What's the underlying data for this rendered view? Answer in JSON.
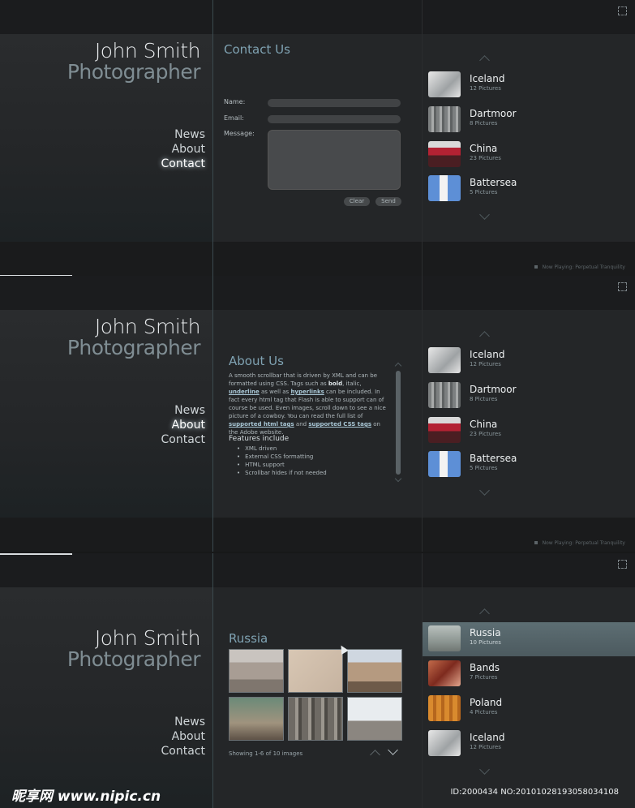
{
  "brand": {
    "name": "John Smith",
    "title": "Photographer"
  },
  "nav": [
    "News",
    "About",
    "Contact"
  ],
  "contact": {
    "title": "Contact Us",
    "labels": {
      "name": "Name:",
      "email": "Email:",
      "message": "Message:"
    },
    "buttons": {
      "clear": "Clear",
      "send": "Send"
    }
  },
  "galleries_a": [
    {
      "title": "Iceland",
      "count": "12 Pictures"
    },
    {
      "title": "Dartmoor",
      "count": "8 Pictures"
    },
    {
      "title": "China",
      "count": "23 Pictures"
    },
    {
      "title": "Battersea",
      "count": "5 Pictures"
    }
  ],
  "galleries_b": [
    {
      "title": "Russia",
      "count": "10 Pictures"
    },
    {
      "title": "Bands",
      "count": "7 Pictures"
    },
    {
      "title": "Poland",
      "count": "4 Pictures"
    },
    {
      "title": "Iceland",
      "count": "12 Pictures"
    }
  ],
  "now_playing": "Now Playing: Perpetual Tranquility",
  "about": {
    "title": "About Us",
    "p1": "A smooth scrollbar that is driven by XML and can be formatted using CSS. Tags such as",
    "bold": "bold",
    "p2": ", italic,",
    "underline": "underline",
    "p3": "as well as",
    "hyperlinks": "hyperlinks",
    "p4": "can be included. In fact every html tag that Flash is able to support can of course be used. Even images, scroll down to see a nice picture of a cowboy. You can read the full list of",
    "link1": "supported html tags",
    "p5": "and",
    "link2": "supported CSS tags",
    "p6": "on the Adobe website.",
    "features_title": "Features include",
    "features": [
      "XML driven",
      "External CSS formatting",
      "HTML support",
      "Scrollbar hides if not needed"
    ]
  },
  "gallery_view": {
    "title": "Russia",
    "showing": "Showing 1-6 of 10 images"
  },
  "footer": {
    "watermark": "昵享网 www.nipic.cn",
    "id": "ID:2000434 NO:20101028193058034108"
  },
  "colors": {
    "accent": "#7fa2b2",
    "bg": "#242628",
    "selected": "#5d6e73"
  }
}
